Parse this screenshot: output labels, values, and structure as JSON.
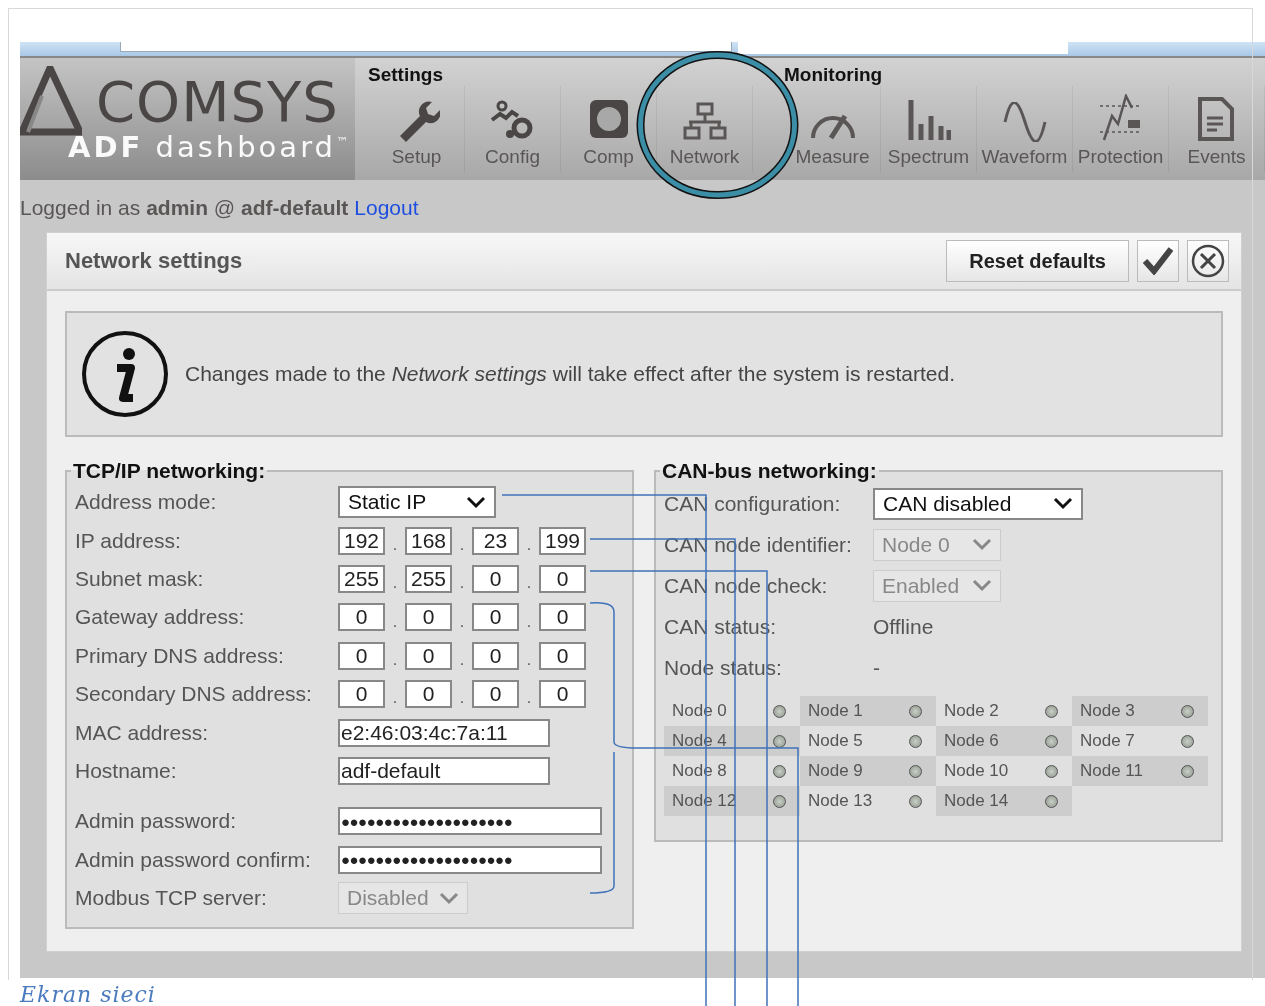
{
  "toolbar": {
    "logo": {
      "brand": "COMSYS",
      "product_bold": "ADF",
      "product": "dashboard",
      "trademark": "™"
    },
    "groups": [
      {
        "title": "Settings",
        "items": [
          {
            "label": "Setup",
            "circled": false
          },
          {
            "label": "Config",
            "circled": false
          },
          {
            "label": "Comp",
            "circled": false
          },
          {
            "label": "Network",
            "circled": true
          }
        ]
      },
      {
        "title": "Monitoring",
        "items": [
          {
            "label": "Measure",
            "circled": false
          },
          {
            "label": "Spectrum",
            "circled": false
          },
          {
            "label": "Waveform",
            "circled": false
          },
          {
            "label": "Protection",
            "circled": false
          },
          {
            "label": "Events",
            "circled": false
          }
        ]
      }
    ]
  },
  "login": {
    "prefix": "Logged in as",
    "user": "admin",
    "at": "@",
    "host": "adf-default",
    "logout": "Logout"
  },
  "panel": {
    "title": "Network settings",
    "reset_button": "Reset defaults",
    "notice": "Changes made to the *Network settings* will take effect after the system is restarted.",
    "tcp": {
      "title": "TCP/IP networking:",
      "rows": [
        {
          "kind": "select",
          "label": "Address mode:",
          "value": "Static IP",
          "disabled": false
        },
        {
          "kind": "octets",
          "label": "IP address:",
          "octets": [
            "192",
            "168",
            "23",
            "199"
          ],
          "separator": "."
        },
        {
          "kind": "octets",
          "label": "Subnet mask:",
          "octets": [
            "255",
            "255",
            "0",
            "0"
          ],
          "separator": "."
        },
        {
          "kind": "octets",
          "label": "Gateway address:",
          "octets": [
            "0",
            "0",
            "0",
            "0"
          ],
          "separator": "."
        },
        {
          "kind": "octets",
          "label": "Primary DNS address:",
          "octets": [
            "0",
            "0",
            "0",
            "0"
          ],
          "separator": "."
        },
        {
          "kind": "octets",
          "label": "Secondary DNS address:",
          "octets": [
            "0",
            "0",
            "0",
            "0"
          ],
          "separator": "."
        },
        {
          "kind": "text",
          "label": "MAC address:",
          "value": "e2:46:03:4c:7a:11"
        },
        {
          "kind": "text",
          "label": "Hostname:",
          "value": "adf-default"
        },
        {
          "kind": "password",
          "label": "Admin password:",
          "value": "●●●●●●●●●●●●●●●●●●●●"
        },
        {
          "kind": "password",
          "label": "Admin password confirm:",
          "value": "●●●●●●●●●●●●●●●●●●●●"
        },
        {
          "kind": "select",
          "label": "Modbus TCP server:",
          "value": "Disabled",
          "disabled": true
        }
      ]
    },
    "can": {
      "title": "CAN-bus networking:",
      "rows": [
        {
          "kind": "select",
          "label": "CAN configuration:",
          "value": "CAN disabled",
          "disabled": false
        },
        {
          "kind": "select",
          "label": "CAN node identifier:",
          "value": "Node 0",
          "disabled": true
        },
        {
          "kind": "select",
          "label": "CAN node check:",
          "value": "Enabled",
          "disabled": true
        },
        {
          "kind": "static",
          "label": "CAN status:",
          "value": "Offline"
        },
        {
          "kind": "static",
          "label": "Node status:",
          "value": "-"
        }
      ],
      "nodes": [
        "Node 0",
        "Node 1",
        "Node 2",
        "Node 3",
        "Node 4",
        "Node 5",
        "Node 6",
        "Node 7",
        "Node 8",
        "Node 9",
        "Node 10",
        "Node 11",
        "Node 12",
        "Node 13",
        "Node 14"
      ]
    }
  },
  "caption": "Ekran sieci"
}
